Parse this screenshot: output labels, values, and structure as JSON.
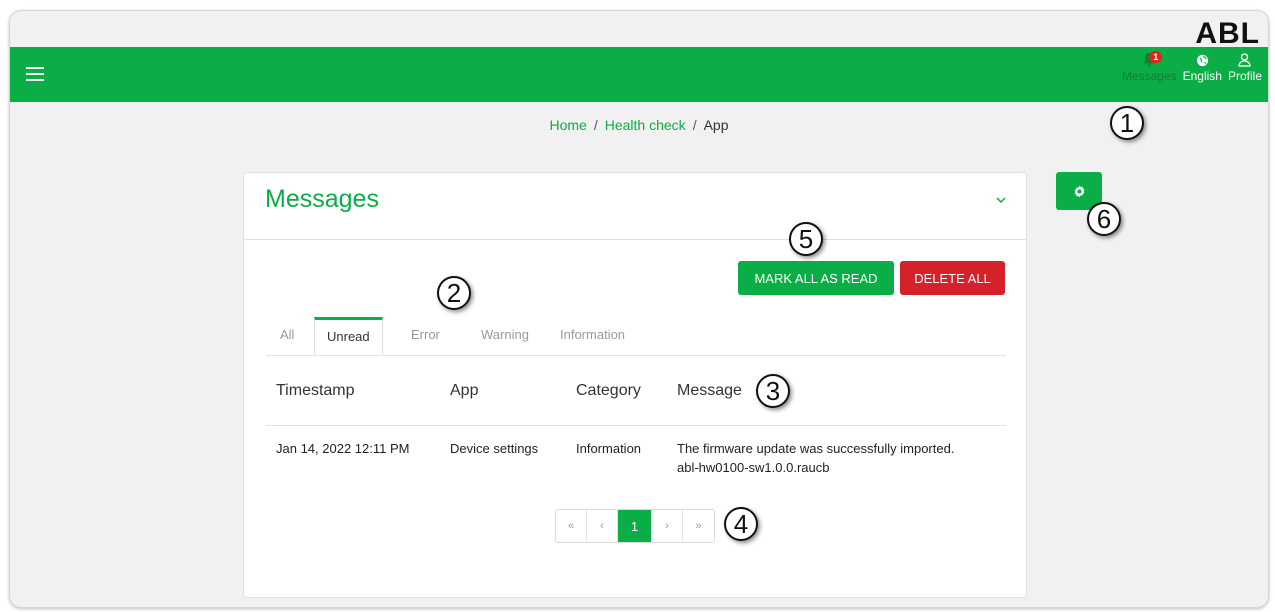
{
  "brand": {
    "logo_text": "ABL",
    "accent": "#0bad46",
    "danger": "#d4212a"
  },
  "topbar": {
    "menu_icon": "hamburger-icon",
    "messages_label": "Messages",
    "messages_count": "1",
    "language_label": "English",
    "profile_label": "Profile"
  },
  "breadcrumb": {
    "items": [
      "Home",
      "Health check",
      "App"
    ]
  },
  "card": {
    "title": "Messages",
    "mark_all_label": "MARK ALL AS READ",
    "delete_all_label": "DELETE ALL",
    "tabs": [
      "All",
      "Unread",
      "Error",
      "Warning",
      "Information"
    ],
    "active_tab": "Unread",
    "columns": [
      "Timestamp",
      "App",
      "Category",
      "Message"
    ],
    "rows": [
      {
        "timestamp": "Jan 14, 2022 12:11 PM",
        "app": "Device settings",
        "category": "Information",
        "message_line1": "The firmware update was successfully imported.",
        "message_line2": "abl-hw0100-sw1.0.0.raucb"
      }
    ],
    "pagination": {
      "first": "«",
      "prev": "‹",
      "current": "1",
      "next": "›",
      "last": "»"
    }
  },
  "callouts": [
    "1",
    "2",
    "3",
    "4",
    "5",
    "6"
  ]
}
